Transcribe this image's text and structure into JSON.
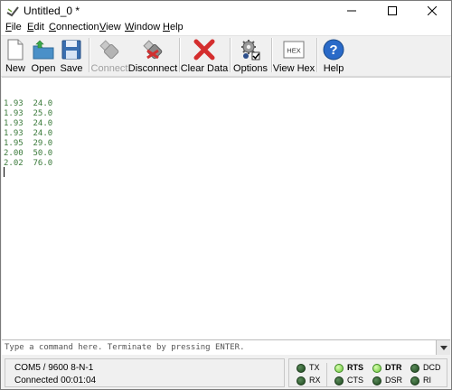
{
  "window": {
    "title": "Untitled_0 *"
  },
  "menu": [
    {
      "pre": "",
      "u": "F",
      "post": "ile"
    },
    {
      "pre": "",
      "u": "E",
      "post": "dit"
    },
    {
      "pre": "",
      "u": "C",
      "post": "onnection"
    },
    {
      "pre": "",
      "u": "V",
      "post": "iew"
    },
    {
      "pre": "",
      "u": "W",
      "post": "indow"
    },
    {
      "pre": "",
      "u": "H",
      "post": "elp"
    }
  ],
  "toolbar": {
    "new": "New",
    "open": "Open",
    "save": "Save",
    "connect": "Connect",
    "disconnect": "Disconnect",
    "clear_data": "Clear Data",
    "options": "Options",
    "view_hex": "View Hex",
    "view_hex_icon_text": "HEX",
    "help": "Help",
    "connect_enabled": false
  },
  "terminal": {
    "lines": [
      "1.93  24.0",
      "1.93  25.0",
      "1.93  24.0",
      "1.93  24.0",
      "1.95  29.0",
      "2.00  50.0",
      "2.02  76.0"
    ],
    "text_color": "#3a7a3a"
  },
  "command": {
    "placeholder": "Type a command here. Terminate by pressing ENTER.",
    "value": ""
  },
  "status": {
    "port": "COM5 / 9600 8-N-1",
    "connection": "Connected 00:01:04"
  },
  "indicators": {
    "tx": {
      "label": "TX",
      "on": false
    },
    "rx": {
      "label": "RX",
      "on": false
    },
    "rts": {
      "label": "RTS",
      "on": true
    },
    "cts": {
      "label": "CTS",
      "on": false
    },
    "dtr": {
      "label": "DTR",
      "on": true
    },
    "dsr": {
      "label": "DSR",
      "on": false
    },
    "dcd": {
      "label": "DCD",
      "on": false
    },
    "ri": {
      "label": "RI",
      "on": false
    }
  }
}
